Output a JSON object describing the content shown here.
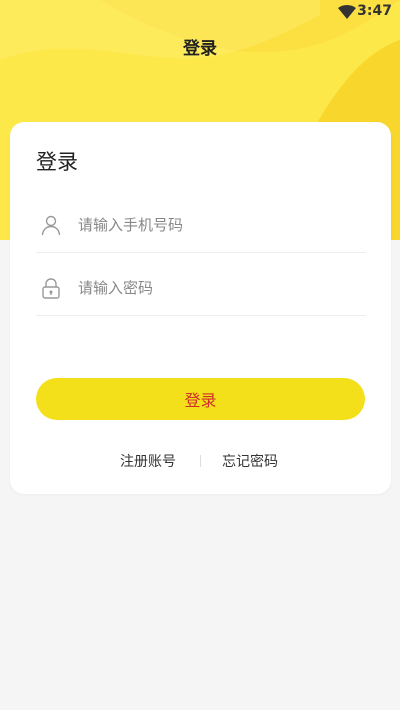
{
  "status_bar": {
    "time": "3:47",
    "wifi_icon": "wifi-icon"
  },
  "header": {
    "title": "登录"
  },
  "card": {
    "title": "登录",
    "phone_field": {
      "placeholder": "请输入手机号码",
      "value": "",
      "icon": "user-icon"
    },
    "password_field": {
      "placeholder": "请输入密码",
      "value": "",
      "icon": "lock-icon"
    },
    "login_button": "登录",
    "register_link": "注册账号",
    "forgot_link": "忘记密码"
  },
  "colors": {
    "header_yellow": "#fde84a",
    "button_yellow": "#f4df1b",
    "button_text": "#d0302a",
    "background": "#f5f5f5"
  }
}
